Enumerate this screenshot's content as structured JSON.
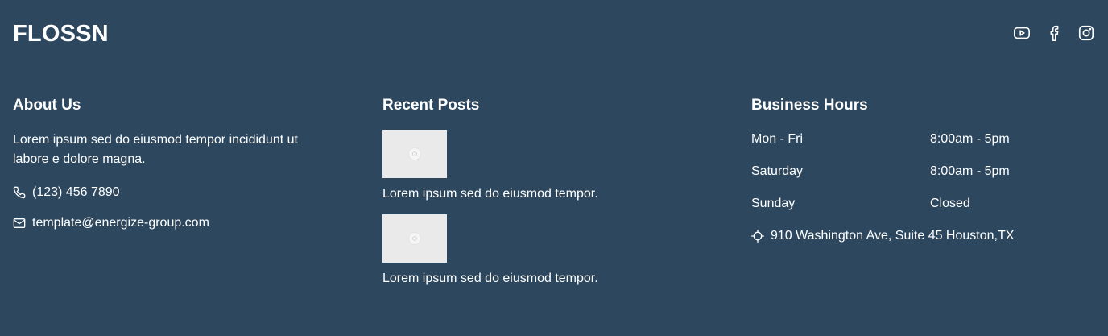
{
  "brand": "FLOSSN",
  "social": [
    {
      "icon": "youtube-icon"
    },
    {
      "icon": "facebook-icon"
    },
    {
      "icon": "instagram-icon"
    }
  ],
  "about": {
    "heading": "About Us",
    "text": "Lorem ipsum sed do eiusmod tempor incididunt ut labore e dolore magna.",
    "phone": "(123) 456 7890",
    "email": "template@energize-group.com"
  },
  "posts": {
    "heading": "Recent Posts",
    "items": [
      {
        "title": "Lorem ipsum sed do eiusmod tempor."
      },
      {
        "title": "Lorem ipsum sed do eiusmod tempor."
      }
    ]
  },
  "hours": {
    "heading": "Business Hours",
    "rows": [
      {
        "day": "Mon - Fri",
        "time": "8:00am - 5pm"
      },
      {
        "day": "Saturday",
        "time": "8:00am - 5pm"
      },
      {
        "day": "Sunday",
        "time": "Closed"
      }
    ],
    "address": "910 Washington Ave, Suite 45 Houston,TX"
  },
  "colors": {
    "background": "#2c475e",
    "text": "#ffffff",
    "thumbnail": "#eaeaea"
  }
}
